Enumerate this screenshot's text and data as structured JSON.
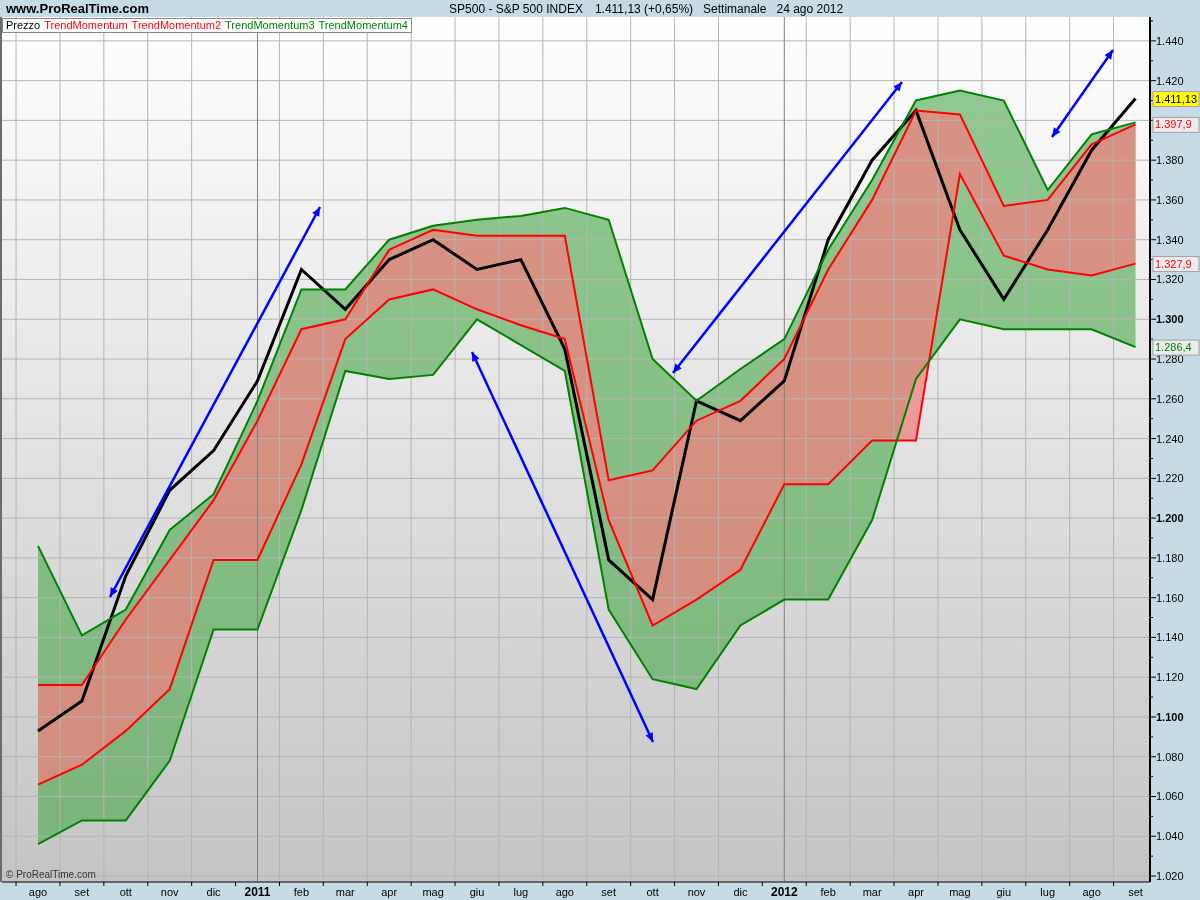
{
  "header": {
    "site": "www.ProRealTime.com",
    "instrument": "SP500 - S&P 500 INDEX",
    "quote": "1.411,13 (+0,65%)",
    "period": "Settimanale",
    "date": "24 ago 2012"
  },
  "chart": {
    "credit": "© ProRealTime.com",
    "price_tags": [
      {
        "kind": "current",
        "label": "1.411,13",
        "color": "#ffff00"
      },
      {
        "kind": "inner_upper",
        "label": "1.397,9",
        "color": "#ff0000"
      },
      {
        "kind": "inner_lower",
        "label": "1.327,9",
        "color": "#ff0000"
      },
      {
        "kind": "outer_lower",
        "label": "1.286,4",
        "color": "#008000"
      }
    ],
    "chart_data": {
      "type": "line",
      "grid": true,
      "categories": [
        "ago",
        "set",
        "ott",
        "nov",
        "dic",
        "2011",
        "feb",
        "mar",
        "apr",
        "mag",
        "giu",
        "lug",
        "ago",
        "set",
        "ott",
        "nov",
        "dic",
        "2012",
        "feb",
        "mar",
        "apr",
        "mag",
        "giu",
        "lug",
        "ago",
        "set"
      ],
      "series": [
        {
          "name": "Prezzo",
          "color": "#000000",
          "values": [
            1093,
            1108,
            1171,
            1214,
            1234,
            1269,
            1325,
            1305,
            1330,
            1340,
            1325,
            1330,
            1285,
            1179,
            1159,
            1259,
            1249,
            1269,
            1340,
            1380,
            1405,
            1345,
            1310,
            1345,
            1385,
            1411
          ]
        },
        {
          "name": "TrendMomentum",
          "color": "#ff0000",
          "values": [
            1116,
            1116,
            1149,
            1179,
            1209,
            1249,
            1295,
            1300,
            1335,
            1345,
            1342,
            1342,
            1342,
            1219,
            1224,
            1249,
            1259,
            1280,
            1325,
            1360,
            1405,
            1403,
            1357,
            1360,
            1388,
            1398
          ]
        },
        {
          "name": "TrendMomentum2",
          "color": "#ff0000",
          "values": [
            1066,
            1076,
            1093,
            1114,
            1179,
            1179,
            1227,
            1290,
            1310,
            1315,
            1305,
            1297,
            1290,
            1199,
            1146,
            1159,
            1174,
            1217,
            1217,
            1239,
            1239,
            1373,
            1332,
            1325,
            1322,
            1328
          ]
        },
        {
          "name": "TrendMomentum3",
          "color": "#008000",
          "values": [
            1186,
            1141,
            1154,
            1194,
            1212,
            1259,
            1315,
            1315,
            1340,
            1347,
            1350,
            1352,
            1356,
            1350,
            1280,
            1259,
            1275,
            1290,
            1335,
            1370,
            1410,
            1415,
            1410,
            1365,
            1393,
            1399
          ]
        },
        {
          "name": "TrendMomentum4",
          "color": "#008000",
          "values": [
            1036,
            1048,
            1048,
            1078,
            1144,
            1144,
            1204,
            1274,
            1270,
            1272,
            1300,
            1287,
            1274,
            1154,
            1119,
            1114,
            1146,
            1159,
            1159,
            1199,
            1270,
            1300,
            1295,
            1295,
            1295,
            1286
          ]
        }
      ],
      "ylim": [
        1017,
        1452
      ],
      "yticks": [
        {
          "value": 1020,
          "label": "1.020"
        },
        {
          "value": 1040,
          "label": "1.040"
        },
        {
          "value": 1060,
          "label": "1.060"
        },
        {
          "value": 1080,
          "label": "1.080"
        },
        {
          "value": 1100,
          "label": "1.100"
        },
        {
          "value": 1120,
          "label": "1.120"
        },
        {
          "value": 1140,
          "label": "1.140"
        },
        {
          "value": 1160,
          "label": "1.160"
        },
        {
          "value": 1180,
          "label": "1.180"
        },
        {
          "value": 1200,
          "label": "1.200"
        },
        {
          "value": 1220,
          "label": "1.220"
        },
        {
          "value": 1240,
          "label": "1.240"
        },
        {
          "value": 1260,
          "label": "1.260"
        },
        {
          "value": 1280,
          "label": "1.280"
        },
        {
          "value": 1300,
          "label": "1.300"
        },
        {
          "value": 1320,
          "label": "1.320"
        },
        {
          "value": 1340,
          "label": "1.340"
        },
        {
          "value": 1360,
          "label": "1.360"
        },
        {
          "value": 1380,
          "label": "1.380"
        },
        {
          "value": 1420,
          "label": "1.420"
        },
        {
          "value": 1440,
          "label": "1.440"
        }
      ]
    }
  }
}
